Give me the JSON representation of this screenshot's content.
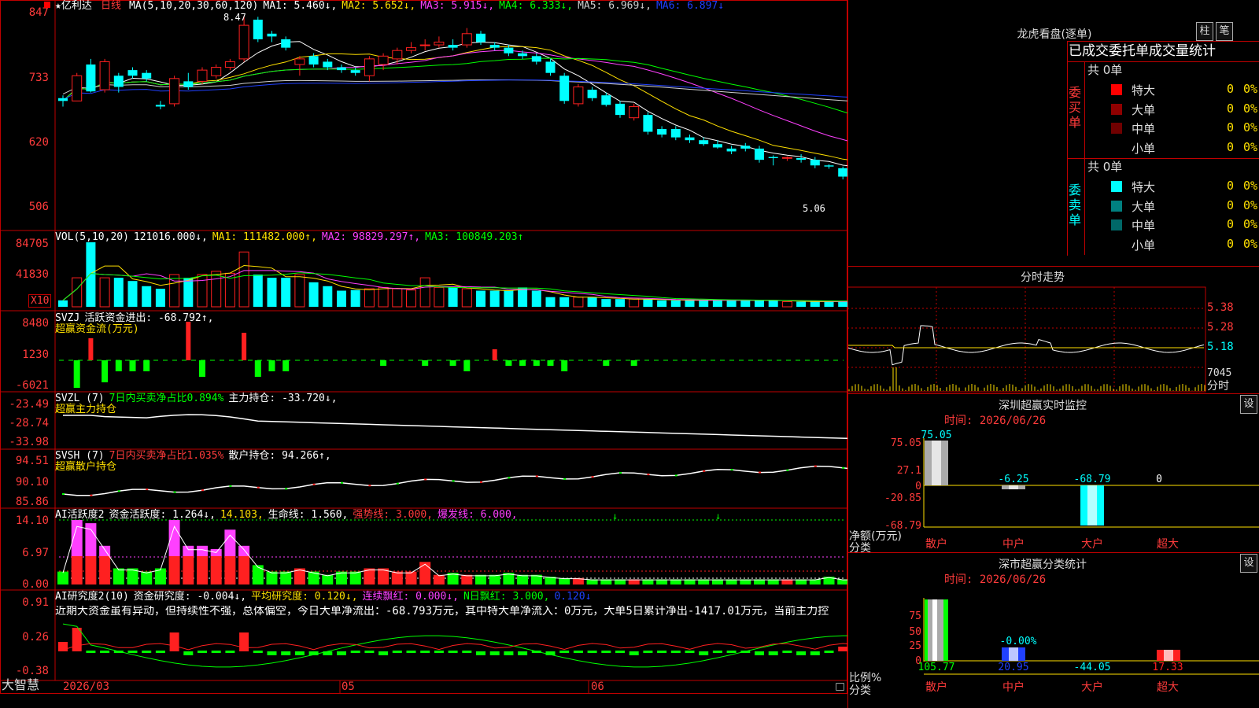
{
  "app": {
    "name": "大智慧"
  },
  "stock": {
    "title": "★亿利达",
    "period": "日线",
    "last_price_marker": "5.06"
  },
  "price_panel": {
    "ma_header": [
      {
        "text": "MA(5,10,20,30,60,120)",
        "color": "#ffffff"
      },
      {
        "text": "MA1: 5.460↓,",
        "color": "#ffffff"
      },
      {
        "text": "MA2: 5.652↓,",
        "color": "#ffe000"
      },
      {
        "text": "MA3: 5.915↓,",
        "color": "#ff40ff"
      },
      {
        "text": "MA4: 6.333↓,",
        "color": "#00ff00"
      },
      {
        "text": "MA5: 6.969↓,",
        "color": "#d0d0d0"
      },
      {
        "text": "MA6: 6.897↓",
        "color": "#2040ff"
      }
    ],
    "y_ticks": [
      "847",
      "733",
      "620",
      "506"
    ],
    "high_marker": "8.47"
  },
  "vol_panel": {
    "header": [
      {
        "text": "VOL(5,10,20)",
        "color": "#ffffff"
      },
      {
        "text": "121016.000↓,",
        "color": "#ffffff"
      },
      {
        "text": "MA1: 111482.000↑,",
        "color": "#ffe000"
      },
      {
        "text": "MA2: 98829.297↑,",
        "color": "#ff40ff"
      },
      {
        "text": "MA3: 100849.203↑",
        "color": "#00ff00"
      }
    ],
    "y_ticks": [
      "84705",
      "41830"
    ],
    "unit": "X10"
  },
  "svzj_panel": {
    "header": [
      {
        "text": "SVZJ",
        "color": "#ffffff"
      },
      {
        "text": "活跃资金进出: -68.792↑,",
        "color": "#ffffff"
      }
    ],
    "subtitle": "超赢资金流(万元)",
    "y_ticks": [
      "8480",
      "1230",
      "-6021"
    ]
  },
  "svzl_panel": {
    "header": [
      {
        "text": "SVZL (7)",
        "color": "#ffffff"
      },
      {
        "text": "7日内买卖净占比0.894%",
        "color": "#00ff00"
      },
      {
        "text": "主力持仓: -33.720↓,",
        "color": "#ffffff"
      }
    ],
    "subtitle": "超赢主力持仓",
    "y_ticks": [
      "-23.49",
      "-28.74",
      "-33.98"
    ]
  },
  "svsh_panel": {
    "header": [
      {
        "text": "SVSH (7)",
        "color": "#ffffff"
      },
      {
        "text": "7日内买卖净占比1.035%",
        "color": "#ff3b3b"
      },
      {
        "text": "散户持仓: 94.266↑,",
        "color": "#ffffff"
      }
    ],
    "subtitle": "超赢散户持仓",
    "y_ticks": [
      "94.51",
      "90.10",
      "85.86"
    ]
  },
  "ai_active_panel": {
    "header": [
      {
        "text": "AI活跃度2",
        "color": "#ffffff"
      },
      {
        "text": "资金活跃度: 1.264↓,",
        "color": "#ffffff"
      },
      {
        "text": "14.103,",
        "color": "#ffe000"
      },
      {
        "text": "生命线: 1.560,",
        "color": "#ffffff"
      },
      {
        "text": "强势线: 3.000,",
        "color": "#ff3b3b"
      },
      {
        "text": "爆发线: 6.000,",
        "color": "#ff40ff"
      }
    ],
    "y_ticks": [
      "14.10",
      "6.97",
      "0.00"
    ]
  },
  "ai_research_panel": {
    "header": [
      {
        "text": "AI研究度2(10)",
        "color": "#ffffff"
      },
      {
        "text": "资金研究度: -0.004↓,",
        "color": "#ffffff"
      },
      {
        "text": "平均研究度: 0.120↓,",
        "color": "#ffe000"
      },
      {
        "text": "连续飘红: 0.000↓,",
        "color": "#ff40ff"
      },
      {
        "text": "N日飘红: 3.000,",
        "color": "#00ff00"
      },
      {
        "text": "0.120↓",
        "color": "#2040ff"
      }
    ],
    "commentary": "近期大资金虽有异动，但持续性不强，总体偏空，今日大单净流出：-68.793万元，其中特大单净流入：0万元，大单5日累计净出-1417.01万元，当前主力控",
    "y_ticks": [
      "0.91",
      "0.26",
      "-0.38"
    ]
  },
  "x_axis": {
    "labels": [
      "2026/03",
      "05",
      "06"
    ]
  },
  "dragon_tiger": {
    "title": "龙虎看盘(逐单)",
    "buttons": [
      "柱",
      "笔"
    ],
    "subtitle": "已成交委托单成交量统计",
    "buy_label": "委买单",
    "sell_label": "委卖单",
    "buy_total": "共 0单",
    "sell_total": "共 0单",
    "buy_rows": [
      {
        "name": "特大",
        "value": "0",
        "pct": "0%",
        "color": "#ff0000"
      },
      {
        "name": "大单",
        "value": "0",
        "pct": "0%",
        "color": "#900000"
      },
      {
        "name": "中单",
        "value": "0",
        "pct": "0%",
        "color": "#700000"
      },
      {
        "name": "小单",
        "value": "0",
        "pct": "0%",
        "color": "#000000"
      }
    ],
    "sell_rows": [
      {
        "name": "特大",
        "value": "0",
        "pct": "0%",
        "color": "#00ffff"
      },
      {
        "name": "大单",
        "value": "0",
        "pct": "0%",
        "color": "#008080"
      },
      {
        "name": "中单",
        "value": "0",
        "pct": "0%",
        "color": "#006868"
      },
      {
        "name": "小单",
        "value": "0",
        "pct": "0%",
        "color": "#000000"
      }
    ]
  },
  "intraday": {
    "title": "分时走势",
    "y_ticks": [
      "5.38",
      "5.28",
      "5.18"
    ],
    "vol_tick": "7045",
    "vol_label": "分时"
  },
  "sz_monitor": {
    "title": "深圳超赢实时监控",
    "settings_label": "设",
    "time": "时间: 2026/06/26",
    "y_ticks": [
      "75.05",
      "27.1",
      "0",
      "-20.85",
      "-68.79"
    ],
    "value_labels": [
      "75.05",
      "-6.25",
      "-68.79",
      "0"
    ],
    "y_title": "净额(万元)",
    "x_title": "分类",
    "categories": [
      "散户",
      "中户",
      "大户",
      "超大"
    ]
  },
  "sz_classify": {
    "title": "深市超赢分类统计",
    "settings_label": "设",
    "time": "时间: 2026/06/26",
    "y_ticks": [
      "75",
      "50",
      "25",
      "0"
    ],
    "pct_label": "-0.00%",
    "values": [
      "105.77",
      "20.95",
      "-44.05",
      "17.33"
    ],
    "y_title": "比例%",
    "x_title": "分类",
    "categories": [
      "散户",
      "中户",
      "大户",
      "超大"
    ]
  },
  "chart_data": [
    {
      "type": "candlestick",
      "title": "亿利达 日线",
      "ylim": [
        5.06,
        8.47
      ],
      "ohlc": [
        [
          7.0,
          7.05,
          6.85,
          6.95
        ],
        [
          6.95,
          7.45,
          6.95,
          7.4
        ],
        [
          7.6,
          7.7,
          7.1,
          7.12
        ],
        [
          7.15,
          7.7,
          7.1,
          7.65
        ],
        [
          7.4,
          7.45,
          7.1,
          7.2
        ],
        [
          7.5,
          7.55,
          7.35,
          7.4
        ],
        [
          7.45,
          7.5,
          7.3,
          7.35
        ],
        [
          6.88,
          6.95,
          6.8,
          6.85
        ],
        [
          6.9,
          7.4,
          6.85,
          7.35
        ],
        [
          7.3,
          7.45,
          7.15,
          7.2
        ],
        [
          7.3,
          7.55,
          7.25,
          7.5
        ],
        [
          7.4,
          7.6,
          7.35,
          7.55
        ],
        [
          7.55,
          7.7,
          7.5,
          7.65
        ],
        [
          7.7,
          8.47,
          7.65,
          8.3
        ],
        [
          8.4,
          8.45,
          8.0,
          8.05
        ],
        [
          8.15,
          8.2,
          8.0,
          8.1
        ],
        [
          8.05,
          8.1,
          7.85,
          7.9
        ],
        [
          7.6,
          7.75,
          7.4,
          7.7
        ],
        [
          7.75,
          7.8,
          7.55,
          7.6
        ],
        [
          7.65,
          7.7,
          7.5,
          7.55
        ],
        [
          7.55,
          7.6,
          7.45,
          7.5
        ],
        [
          7.5,
          7.55,
          7.4,
          7.45
        ],
        [
          7.4,
          7.75,
          7.3,
          7.7
        ],
        [
          7.6,
          7.8,
          7.5,
          7.75
        ],
        [
          7.7,
          7.9,
          7.6,
          7.85
        ],
        [
          7.85,
          8.0,
          7.8,
          7.9
        ],
        [
          7.95,
          8.05,
          7.85,
          7.95
        ],
        [
          7.95,
          8.1,
          7.9,
          8.0
        ],
        [
          7.95,
          8.05,
          7.85,
          7.9
        ],
        [
          7.95,
          8.25,
          7.9,
          8.15
        ],
        [
          8.15,
          8.2,
          7.95,
          8.0
        ],
        [
          7.95,
          8.0,
          7.85,
          7.9
        ],
        [
          7.9,
          7.95,
          7.75,
          7.8
        ],
        [
          7.8,
          7.85,
          7.7,
          7.75
        ],
        [
          7.75,
          7.8,
          7.6,
          7.65
        ],
        [
          7.65,
          7.7,
          7.4,
          7.45
        ],
        [
          7.4,
          7.45,
          6.9,
          6.95
        ],
        [
          6.9,
          7.25,
          6.85,
          7.2
        ],
        [
          7.15,
          7.2,
          6.95,
          7.0
        ],
        [
          7.05,
          7.1,
          6.85,
          6.88
        ],
        [
          6.9,
          6.95,
          6.65,
          6.7
        ],
        [
          6.65,
          6.9,
          6.6,
          6.85
        ],
        [
          6.7,
          6.75,
          6.35,
          6.4
        ],
        [
          6.45,
          6.5,
          6.3,
          6.35
        ],
        [
          6.45,
          6.5,
          6.25,
          6.3
        ],
        [
          6.3,
          6.35,
          6.2,
          6.25
        ],
        [
          6.25,
          6.3,
          6.15,
          6.18
        ],
        [
          6.18,
          6.25,
          6.1,
          6.12
        ],
        [
          6.1,
          6.15,
          6.0,
          6.05
        ],
        [
          6.15,
          6.2,
          6.05,
          6.1
        ],
        [
          6.1,
          6.15,
          5.85,
          5.9
        ],
        [
          5.95,
          5.98,
          5.8,
          5.93
        ],
        [
          5.93,
          5.96,
          5.88,
          5.94
        ],
        [
          5.93,
          6.0,
          5.85,
          5.9
        ],
        [
          5.9,
          5.95,
          5.75,
          5.8
        ],
        [
          5.8,
          5.82,
          5.74,
          5.78
        ],
        [
          5.75,
          5.78,
          5.55,
          5.6
        ],
        [
          5.75,
          5.82,
          5.7,
          5.8
        ],
        [
          5.75,
          5.78,
          5.55,
          5.6
        ],
        [
          5.55,
          5.58,
          5.4,
          5.42
        ],
        [
          5.35,
          5.38,
          5.2,
          5.22
        ]
      ]
    }
  ]
}
